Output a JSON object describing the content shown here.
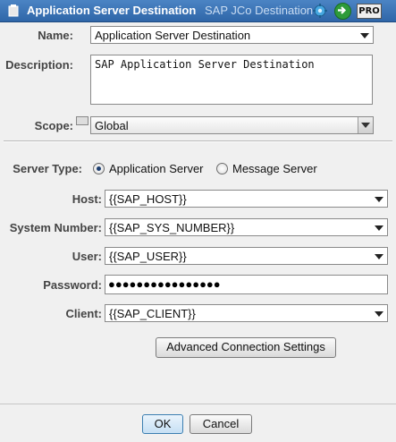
{
  "window": {
    "title": "Application Server Destination",
    "subtitle": "SAP JCo Destination",
    "pro_badge": "PRO"
  },
  "form": {
    "name_label": "Name:",
    "name_value": "Application Server Destination",
    "description_label": "Description:",
    "description_value": "SAP Application Server Destination",
    "scope_label": "Scope:",
    "scope_value": "Global",
    "server_type_label": "Server Type:",
    "server_type_options": [
      "Application Server",
      "Message Server"
    ],
    "server_type_selected": "Application Server",
    "host_label": "Host:",
    "host_value": "{{SAP_HOST}}",
    "sysnum_label": "System Number:",
    "sysnum_value": "{{SAP_SYS_NUMBER}}",
    "user_label": "User:",
    "user_value": "{{SAP_USER}}",
    "password_label": "Password:",
    "password_value": "●●●●●●●●●●●●●●●●",
    "client_label": "Client:",
    "client_value": "{{SAP_CLIENT}}",
    "advanced_button": "Advanced Connection Settings"
  },
  "footer": {
    "ok": "OK",
    "cancel": "Cancel"
  },
  "colors": {
    "titlebar": "#3a73b5",
    "background": "#f0f0f0"
  }
}
